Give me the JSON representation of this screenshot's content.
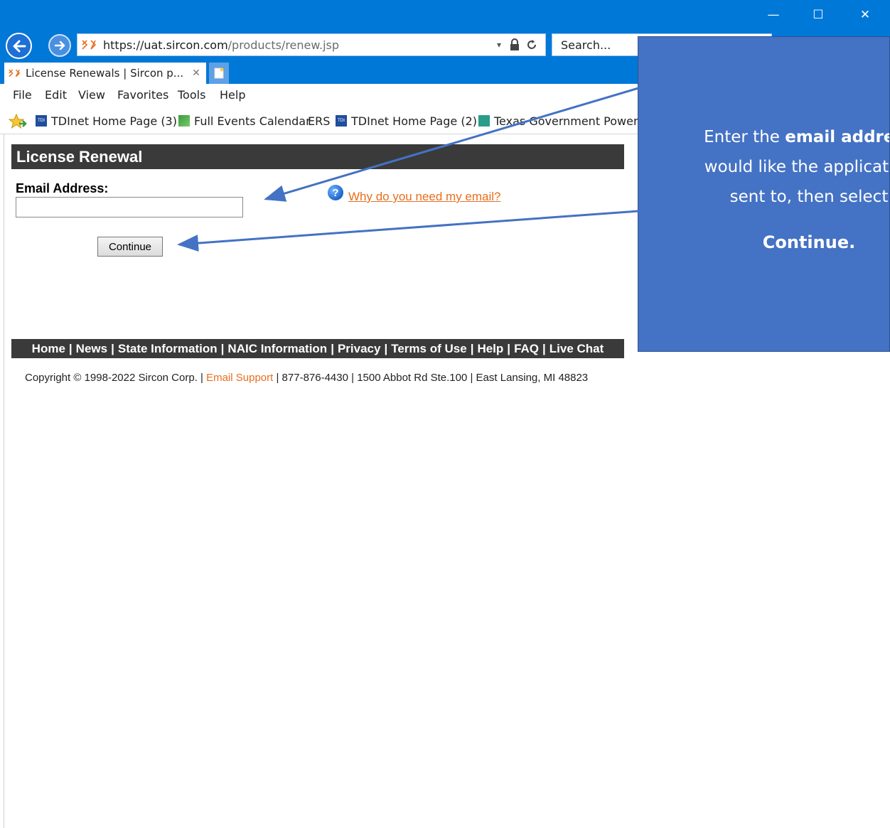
{
  "window": {
    "controls": [
      "—",
      "☐",
      "✕"
    ]
  },
  "browser": {
    "url_scheme": "https://",
    "url_host": "uat.sircon.com",
    "url_path": "/products/renew.jsp",
    "search_placeholder": "Search...",
    "tab_title": "License Renewals | Sircon p...",
    "tab_close": "✕"
  },
  "menu": {
    "items": [
      "File",
      "Edit",
      "View",
      "Favorites",
      "Tools",
      "Help"
    ]
  },
  "favorites": {
    "items": [
      "TDInet Home Page (3)",
      "Full Events Calendar",
      "ERS",
      "TDInet Home Page (2)",
      "Texas Government Power P"
    ]
  },
  "page": {
    "title": "License Renewal",
    "email_label": "Email Address:",
    "email_value": "",
    "help_link": "Why do you need my email?",
    "continue_label": "Continue"
  },
  "footer": {
    "links": [
      "Home",
      "News",
      "State Information",
      "NAIC Information",
      "Privacy",
      "Terms of Use",
      "Help",
      "FAQ",
      "Live Chat"
    ],
    "copyright_prefix": "Copyright © 1998-2022 Sircon Corp. |",
    "email_support": "Email Support",
    "copyright_suffix": "| 877-876-4430 | 1500 Abbot Rd Ste.100 | East Lansing, MI 48823"
  },
  "callout": {
    "line1_pre": "Enter the ",
    "line1_bold": "email address",
    "line2": "would like the application",
    "line3": "sent to, then select",
    "line4": "Continue."
  },
  "colors": {
    "titlebar": "#0078d7",
    "callout": "#4472c4",
    "link": "#e86e1e",
    "header_bar": "#3a3a3a"
  }
}
